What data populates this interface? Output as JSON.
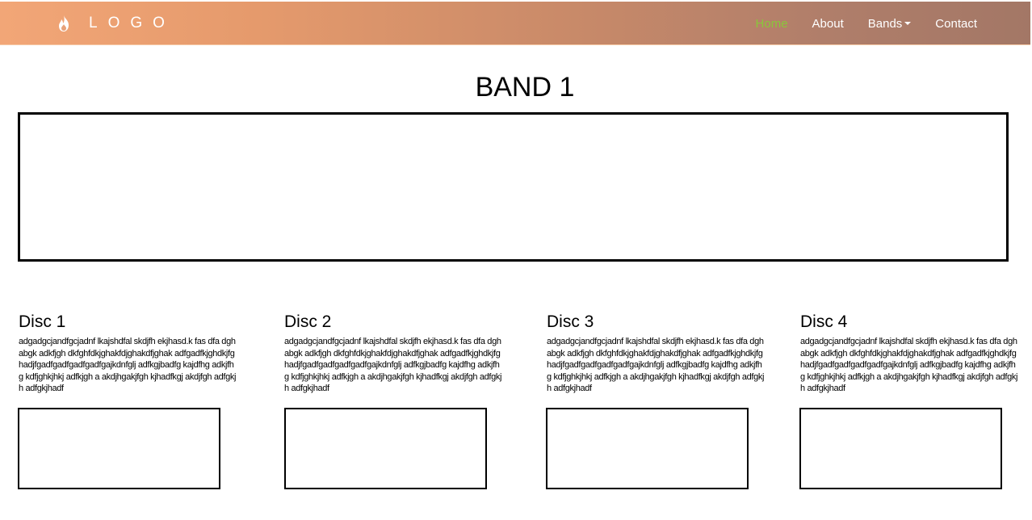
{
  "navbar": {
    "brand_icon": "flame-icon",
    "brand_text": "LOGO",
    "links": [
      {
        "label": "Home",
        "active": true
      },
      {
        "label": "About",
        "active": false
      },
      {
        "label": "Bands",
        "active": false,
        "dropdown": true
      },
      {
        "label": "Contact",
        "active": false
      }
    ],
    "active_color": "#8ac63a"
  },
  "page": {
    "title": "BAND 1"
  },
  "discs": [
    {
      "title": "Disc 1",
      "text": "adgadgcjandfgcjadnf lkajshdfal skdjfh ekjhasd.k fas dfa dghabgk adkfjgh dkfghfdkjghakfdjghakdfjghak adfgadfkjghdkjfghadjfgadfgadfgadfgadfgajkdnfglj adfkgjbadfg  kajdfhg adkjfhg kdfjghkjhkj adfkjgh a akdjhgakjfgh kjhadfkgj akdjfgh adfgkjh adfgkjhadf"
    },
    {
      "title": "Disc 2",
      "text": "adgadgcjandfgcjadnf lkajshdfal skdjfh ekjhasd.k fas dfa dghabgk adkfjgh dkfghfdkjghakfdjghakdfjghak adfgadfkjghdkjfghadjfgadfgadfgadfgadfgajkdnfglj adfkgjbadfg  kajdfhg adkjfhg kdfjghkjhkj adfkjgh a akdjhgakjfgh kjhadfkgj akdjfgh adfgkjh adfgkjhadf"
    },
    {
      "title": "Disc 3",
      "text": "adgadgcjandfgcjadnf lkajshdfal skdjfh ekjhasd.k fas dfa dghabgk adkfjgh dkfghfdkjghakfdjghakdfjghak adfgadfkjghdkjfghadjfgadfgadfgadfgadfgajkdnfglj adfkgjbadfg  kajdfhg adkjfhg kdfjghkjhkj adfkjgh a akdjhgakjfgh kjhadfkgj akdjfgh adfgkjh adfgkjhadf"
    },
    {
      "title": "Disc 4",
      "text": "adgadgcjandfgcjadnf lkajshdfal skdjfh ekjhasd.k fas dfa dghabgk adkfjgh dkfghfdkjghakfdjghakdfjghak adfgadfkjghdkjfghadjfgadfgadfgadfgadfgajkdnfglj adfkgjbadfg  kajdfhg adkjfhg kdfjghkjhkj adfkjgh a akdjhgakjfgh kjhadfkgj akdjfgh adfgkjh adfgkjhadf"
    }
  ]
}
